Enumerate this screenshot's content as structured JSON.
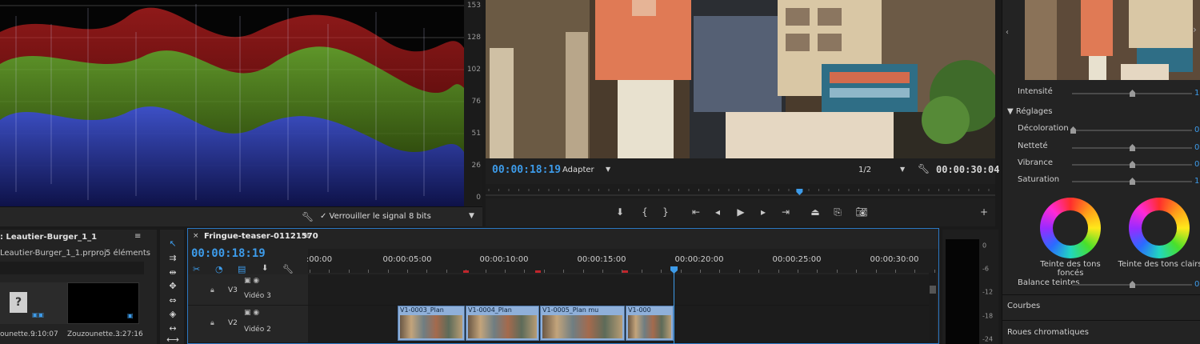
{
  "scope": {
    "y_ticks": [
      "153",
      "128",
      "102",
      "76",
      "51",
      "26",
      "0"
    ],
    "lock_label": "✓ Verrouiller le signal",
    "bit_depth": "8 bits"
  },
  "monitor": {
    "timecode_current": "00:00:18:19",
    "fit": "Adapter",
    "resolution": "1/2",
    "timecode_duration": "00:00:30:04",
    "playhead_fraction": 0.616
  },
  "project": {
    "title": ": Leautier-Burger_1_1",
    "file": "Leautier-Burger_1_1.prproj",
    "count": "5 éléments",
    "items": [
      {
        "name": "ounette…",
        "duration": "9:10:07"
      },
      {
        "name": "Zouzounette…",
        "duration": "3:27:16"
      }
    ]
  },
  "timeline": {
    "sequence_name": "Fringue-teaser-01121570",
    "timecode": "00:00:18:19",
    "ruler_labels": [
      ":00:00",
      "00:00:05:00",
      "00:00:10:00",
      "00:00:15:00",
      "00:00:20:00",
      "00:00:25:00",
      "00:00:30:00"
    ],
    "tracks": [
      {
        "id": "V3",
        "name": "Vidéo 3"
      },
      {
        "id": "V2",
        "name": "Vidéo 2"
      }
    ],
    "clips": [
      {
        "label": "V1-0003_Plan"
      },
      {
        "label": "V1-0004_Plan"
      },
      {
        "label": "V1-0005_Plan mu"
      },
      {
        "label": "V1-000"
      }
    ]
  },
  "meters": {
    "ticks": [
      "0",
      "-6",
      "-12",
      "-18",
      "-24"
    ]
  },
  "lumetri": {
    "intensity_label": "Intensité",
    "intensity_value": "1",
    "section_reglages": "Réglages",
    "sliders": [
      {
        "label": "Décoloration",
        "value": "0,"
      },
      {
        "label": "Netteté",
        "value": "0,"
      },
      {
        "label": "Vibrance",
        "value": "0,"
      },
      {
        "label": "Saturation",
        "value": "1"
      }
    ],
    "wheel_shadows": "Teinte des tons foncés",
    "wheel_highlights": "Teinte des tons clairs",
    "balance_label": "Balance teintes",
    "balance_value": "0,",
    "section_courbes": "Courbes",
    "section_roues": "Roues chromatiques"
  },
  "colors": {
    "accent": "#3d9be9",
    "clip": "#8fb0da",
    "marker": "#c0262c",
    "panel": "#232323"
  }
}
